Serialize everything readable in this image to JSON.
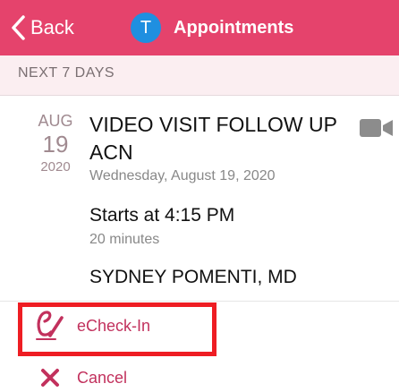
{
  "header": {
    "back_label": "Back",
    "avatar_initial": "T",
    "title": "Appointments"
  },
  "section": {
    "label": "NEXT 7 DAYS"
  },
  "appointment": {
    "month": "AUG",
    "day": "19",
    "year": "2020",
    "title": "VIDEO VISIT FOLLOW UP ACN",
    "full_date": "Wednesday, August 19, 2020",
    "starts": "Starts at 4:15 PM",
    "duration": "20 minutes",
    "provider": "SYDNEY POMENTI, MD",
    "visit_icon": "video-camera-icon"
  },
  "actions": {
    "checkin_label": "eCheck-In",
    "checkin_icon": "echeckin-icon",
    "cancel_label": "Cancel",
    "cancel_icon": "close-icon"
  },
  "colors": {
    "header_bg": "#e5436c",
    "accent": "#c2315d",
    "avatar": "#1f8fe0",
    "section_bg": "#fbeef1",
    "highlight": "#ee1d23"
  }
}
